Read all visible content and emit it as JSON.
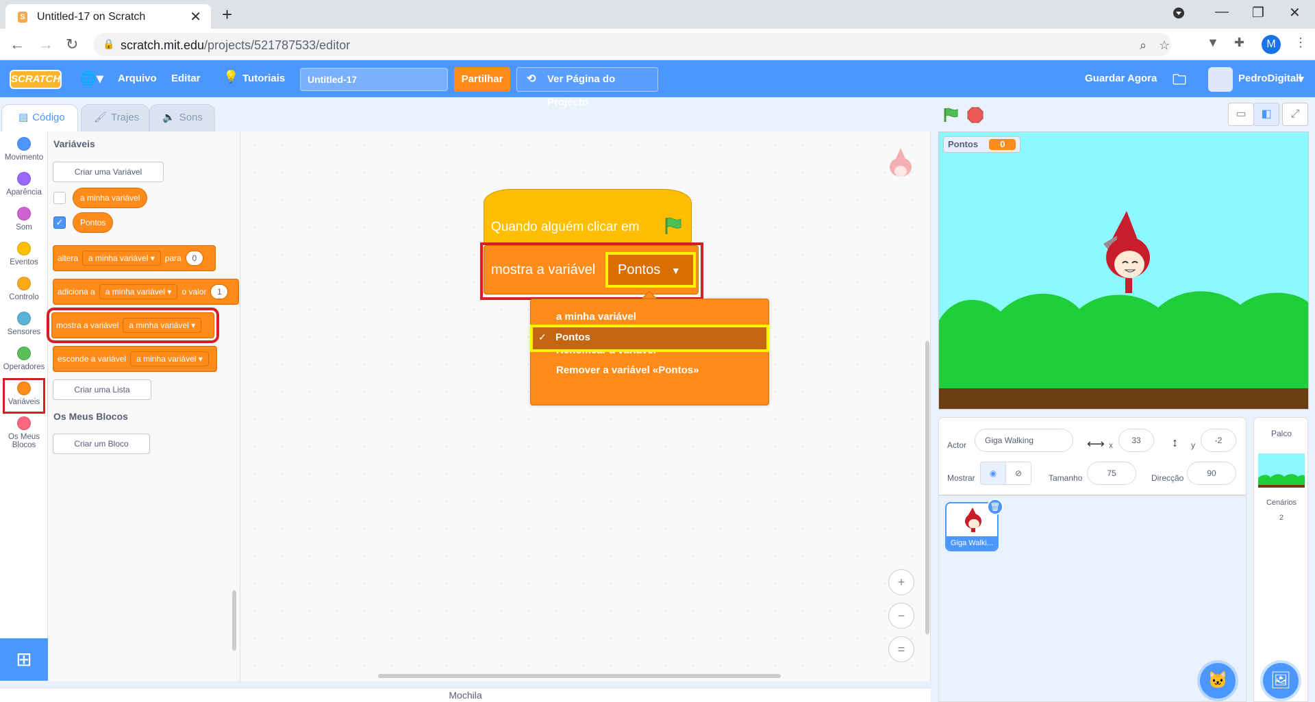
{
  "browser": {
    "tab_title": "Untitled-17 on Scratch",
    "favicon": "S",
    "url_domain": "scratch.mit.edu",
    "url_path": "/projects/521787533/editor",
    "profile_initial": "M"
  },
  "menubar": {
    "logo": "SCRATCH",
    "file": "Arquivo",
    "edit": "Editar",
    "tutorials": "Tutoriais",
    "project_title": "Untitled-17",
    "share": "Partilhar",
    "see_project": "Ver Página do Projecto",
    "save_now": "Guardar Agora",
    "username": "PedroDigitall"
  },
  "editor_tabs": {
    "code": "Código",
    "costumes": "Trajes",
    "sounds": "Sons"
  },
  "categories": [
    {
      "label": "Movimento",
      "color": "#4c97ff"
    },
    {
      "label": "Aparência",
      "color": "#9966ff"
    },
    {
      "label": "Som",
      "color": "#cf63cf"
    },
    {
      "label": "Eventos",
      "color": "#ffbf00"
    },
    {
      "label": "Controlo",
      "color": "#ffab19"
    },
    {
      "label": "Sensores",
      "color": "#5cb1d6"
    },
    {
      "label": "Operadores",
      "color": "#59c059"
    },
    {
      "label": "Variáveis",
      "color": "#ff8c1a"
    },
    {
      "label": "Os Meus Blocos",
      "color": "#ff6680"
    }
  ],
  "palette": {
    "heading": "Variáveis",
    "make_variable": "Criar uma Variável",
    "var1": "a minha variável",
    "var2": "Pontos",
    "set_block": {
      "word1": "altera",
      "drop": "a minha variável",
      "word2": "para",
      "value": "0"
    },
    "change_block": {
      "word1": "adiciona a",
      "drop": "a minha variável",
      "word2": "o valor",
      "value": "1"
    },
    "show_block": {
      "word1": "mostra a variável",
      "drop": "a minha variável"
    },
    "hide_block": {
      "word1": "esconde a variável",
      "drop": "a minha variável"
    },
    "make_list": "Criar uma Lista",
    "my_blocks_heading": "Os Meus Blocos",
    "make_block": "Criar um Bloco"
  },
  "script": {
    "hat_text": "Quando alguém clicar em",
    "show_text": "mostra a variável",
    "show_value": "Pontos"
  },
  "dropdown": {
    "items": [
      "a minha variável",
      "Pontos",
      "Renomear a variável",
      "Remover a variável «Pontos»"
    ],
    "checkmark": "✓"
  },
  "workspace": {
    "zoom_in": "+",
    "zoom_out": "−",
    "zoom_reset": "=",
    "backpack": "Mochila"
  },
  "stage": {
    "monitor_label": "Pontos",
    "monitor_value": "0"
  },
  "sprite_info": {
    "sprite_label": "Actor",
    "sprite_name": "Giga Walking",
    "x_label": "x",
    "x_value": "33",
    "y_label": "y",
    "y_value": "-2",
    "show_label": "Mostrar",
    "size_label": "Tamanho",
    "size_value": "75",
    "direction_label": "Direcção",
    "direction_value": "90",
    "thumb_name": "Giga Walki..."
  },
  "stage_panel": {
    "title": "Palco",
    "backdrops_label": "Cenários",
    "backdrops_count": "2"
  }
}
